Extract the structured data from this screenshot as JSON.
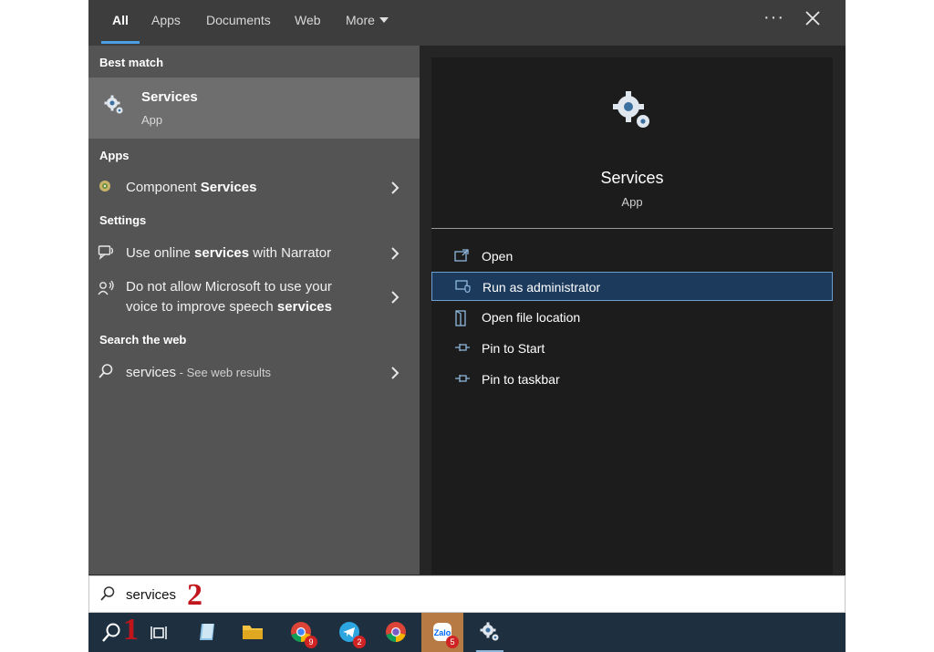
{
  "tabs": [
    {
      "label": "All",
      "active": true
    },
    {
      "label": "Apps"
    },
    {
      "label": "Documents"
    },
    {
      "label": "Web"
    },
    {
      "label": "More"
    }
  ],
  "window_controls": {
    "more_options": "···",
    "close": "close-icon"
  },
  "left_pane": {
    "best_match": {
      "header": "Best match",
      "title": "Services",
      "subtitle": "App",
      "icon": "services-gear-icon"
    },
    "apps": {
      "header": "Apps",
      "items": [
        {
          "prefix": "Component ",
          "highlight": "Services",
          "icon": "component-services-icon"
        }
      ]
    },
    "settings": {
      "header": "Settings",
      "items": [
        {
          "prefix": "Use online ",
          "highlight": "services",
          "suffix": " with Narrator",
          "icon": "narrator-icon"
        },
        {
          "line1": "Do not allow Microsoft to use your",
          "prefix": "voice to improve speech ",
          "highlight": "services",
          "icon": "speech-icon"
        }
      ]
    },
    "web": {
      "header": "Search the web",
      "items": [
        {
          "query": "services",
          "suffix": " - See web results",
          "icon": "search-icon"
        }
      ]
    }
  },
  "preview": {
    "title": "Services",
    "subtitle": "App",
    "icon": "services-gear-icon",
    "actions": [
      {
        "label": "Open",
        "icon": "open-icon"
      },
      {
        "label": "Run as administrator",
        "icon": "run-as-admin-icon",
        "selected": true
      },
      {
        "label": "Open file location",
        "icon": "file-location-icon"
      },
      {
        "label": "Pin to Start",
        "icon": "pin-icon"
      },
      {
        "label": "Pin to taskbar",
        "icon": "pin-icon"
      }
    ]
  },
  "search": {
    "value": "services",
    "placeholder": ""
  },
  "annotations": {
    "step1": "1",
    "step2": "2"
  },
  "taskbar": {
    "items": [
      {
        "icon": "search-icon"
      },
      {
        "icon": "task-view-icon"
      },
      {
        "icon": "notepad-icon"
      },
      {
        "icon": "file-explorer-icon"
      },
      {
        "icon": "chrome-icon",
        "badge": "9"
      },
      {
        "icon": "telegram-icon",
        "badge": "2"
      },
      {
        "icon": "chrome-alt-icon"
      },
      {
        "icon": "zalo-icon",
        "badge": "5",
        "active": true
      },
      {
        "icon": "services-gear-icon",
        "running": true
      }
    ]
  },
  "colors": {
    "accent": "#4aa0e6",
    "selected_action": "#1b3a5c",
    "step_label": "#c0151b",
    "taskbar": "#1e3040",
    "active_taskbar_item": "#b87a45"
  }
}
